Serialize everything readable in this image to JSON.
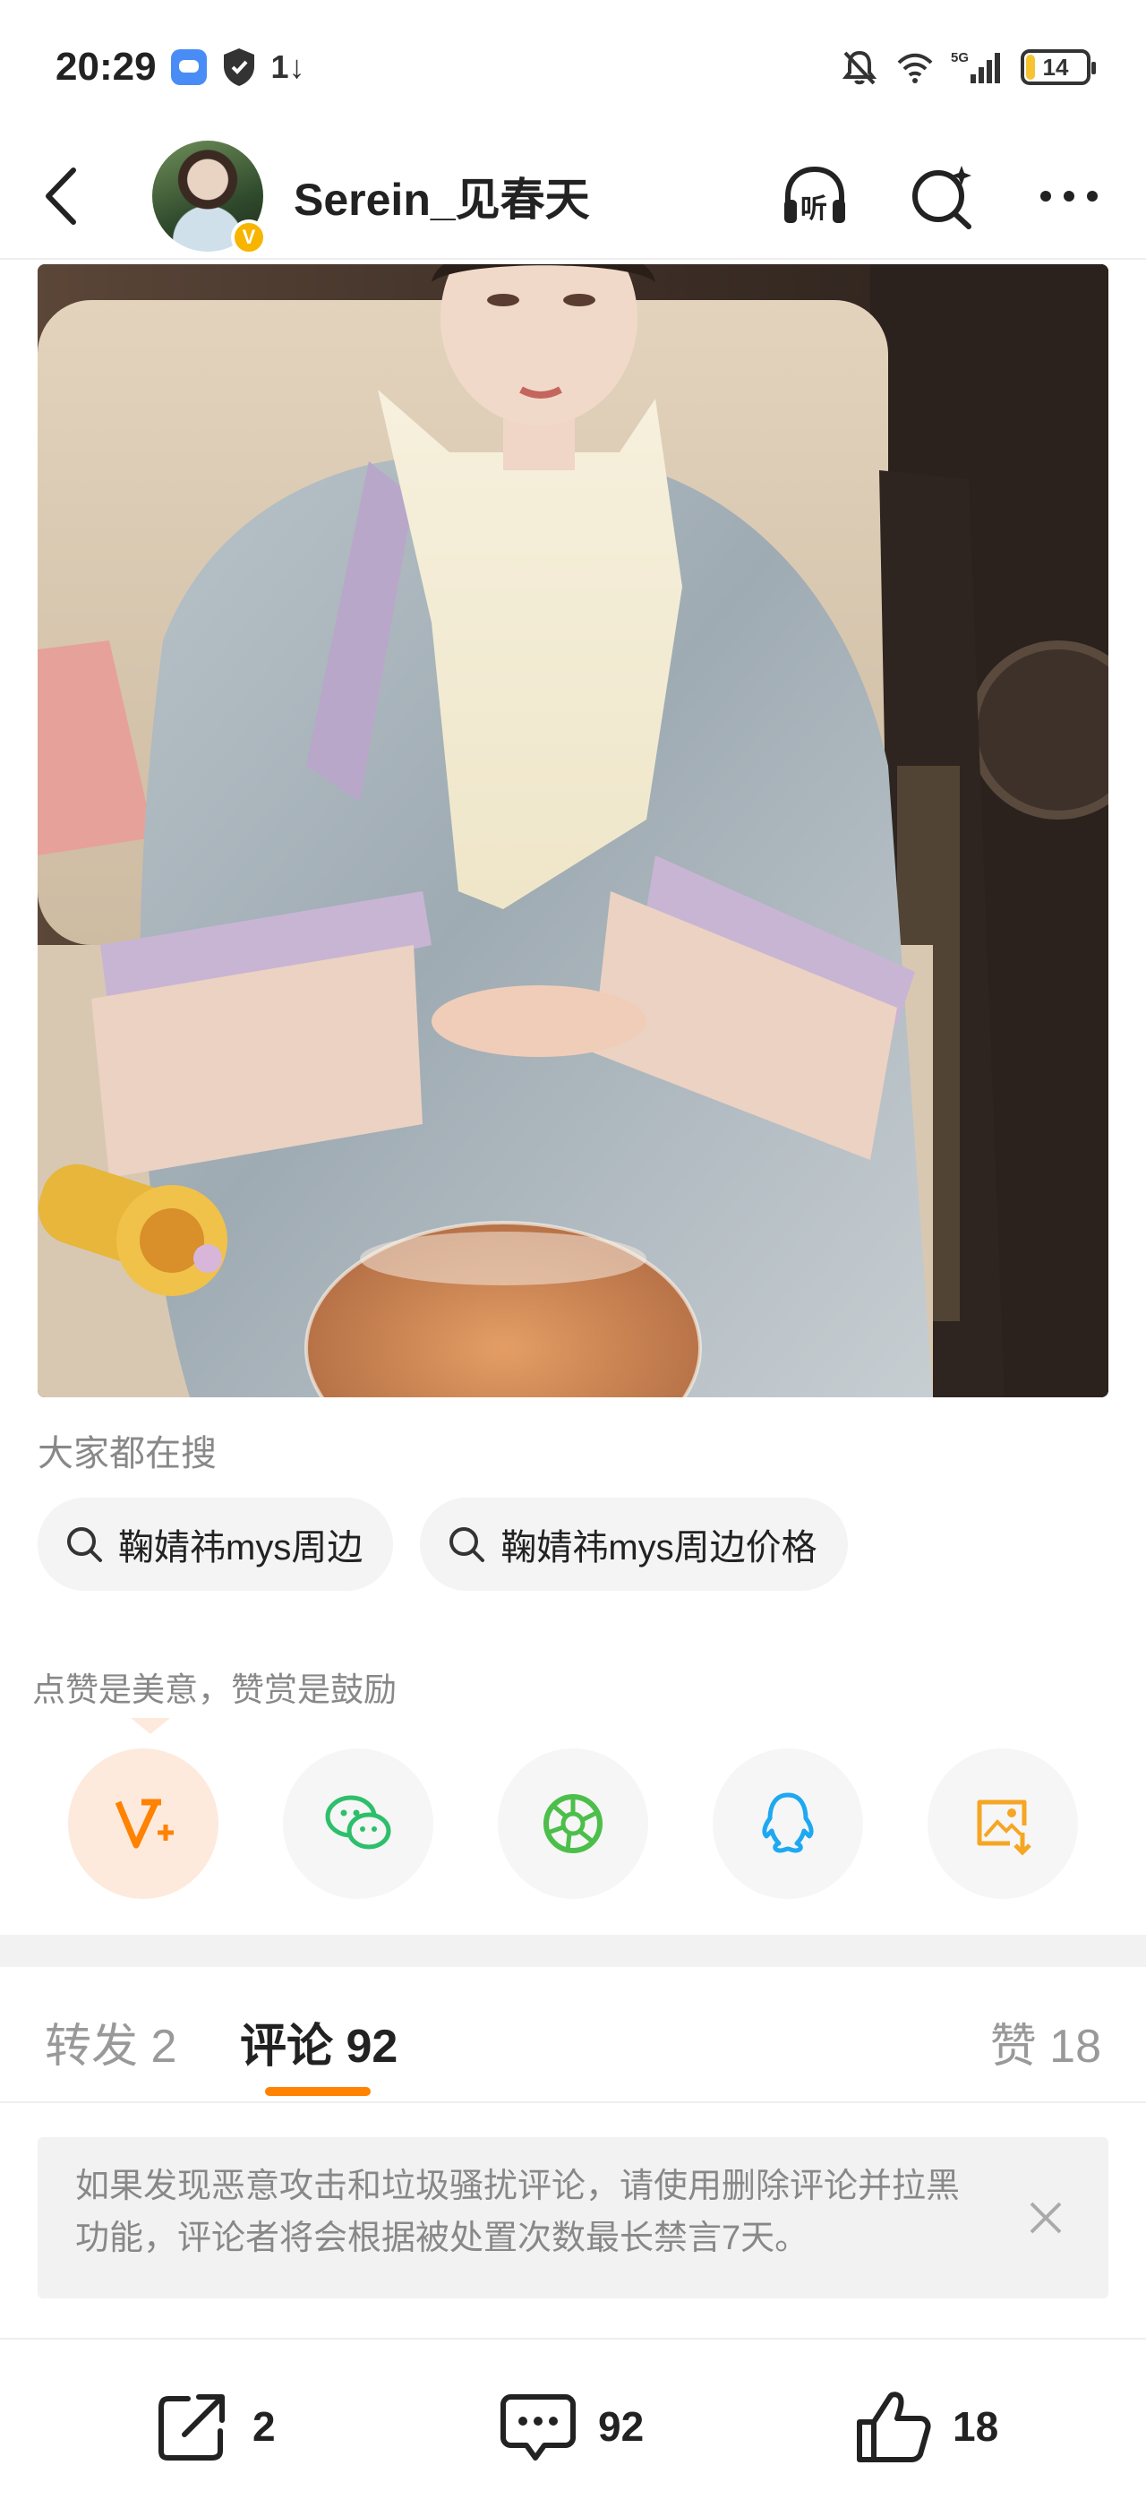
{
  "status_bar": {
    "time": "20:29",
    "data_arrows": "1↓",
    "network": "5G",
    "battery": "14",
    "battery_level_percent": 14
  },
  "header": {
    "username": "Serein_见春天",
    "verified_mark": "V",
    "listen_label": "听",
    "icons": [
      "back-arrow-icon",
      "listen-headphones-icon",
      "search-sparkle-icon",
      "more-dots-icon"
    ]
  },
  "hot_search": {
    "title": "大家都在搜",
    "chips": [
      {
        "label": "鞠婧祎mys周边"
      },
      {
        "label": "鞠婧祎mys周边价格"
      }
    ]
  },
  "reward": {
    "text": "点赞是美意，赞赏是鼓励",
    "share_buttons": [
      "reward-icon",
      "wechat-icon",
      "moments-icon",
      "qq-icon",
      "save-image-icon"
    ]
  },
  "tabs": {
    "repost": "转发 2",
    "comments": "评论 92",
    "likes": "赞 18"
  },
  "notice": {
    "text": "如果发现恶意攻击和垃圾骚扰评论，请使用删除评论并拉黑功能，评论者将会根据被处置次数最长禁言7天。"
  },
  "bottom_bar": {
    "repost_count": "2",
    "comment_count": "92",
    "like_count": "18"
  },
  "colors": {
    "accent": "#ff8200",
    "verified": "#f7b500",
    "wechat": "#2dbf6b",
    "qq": "#1fa8f2",
    "save": "#f5a623"
  }
}
